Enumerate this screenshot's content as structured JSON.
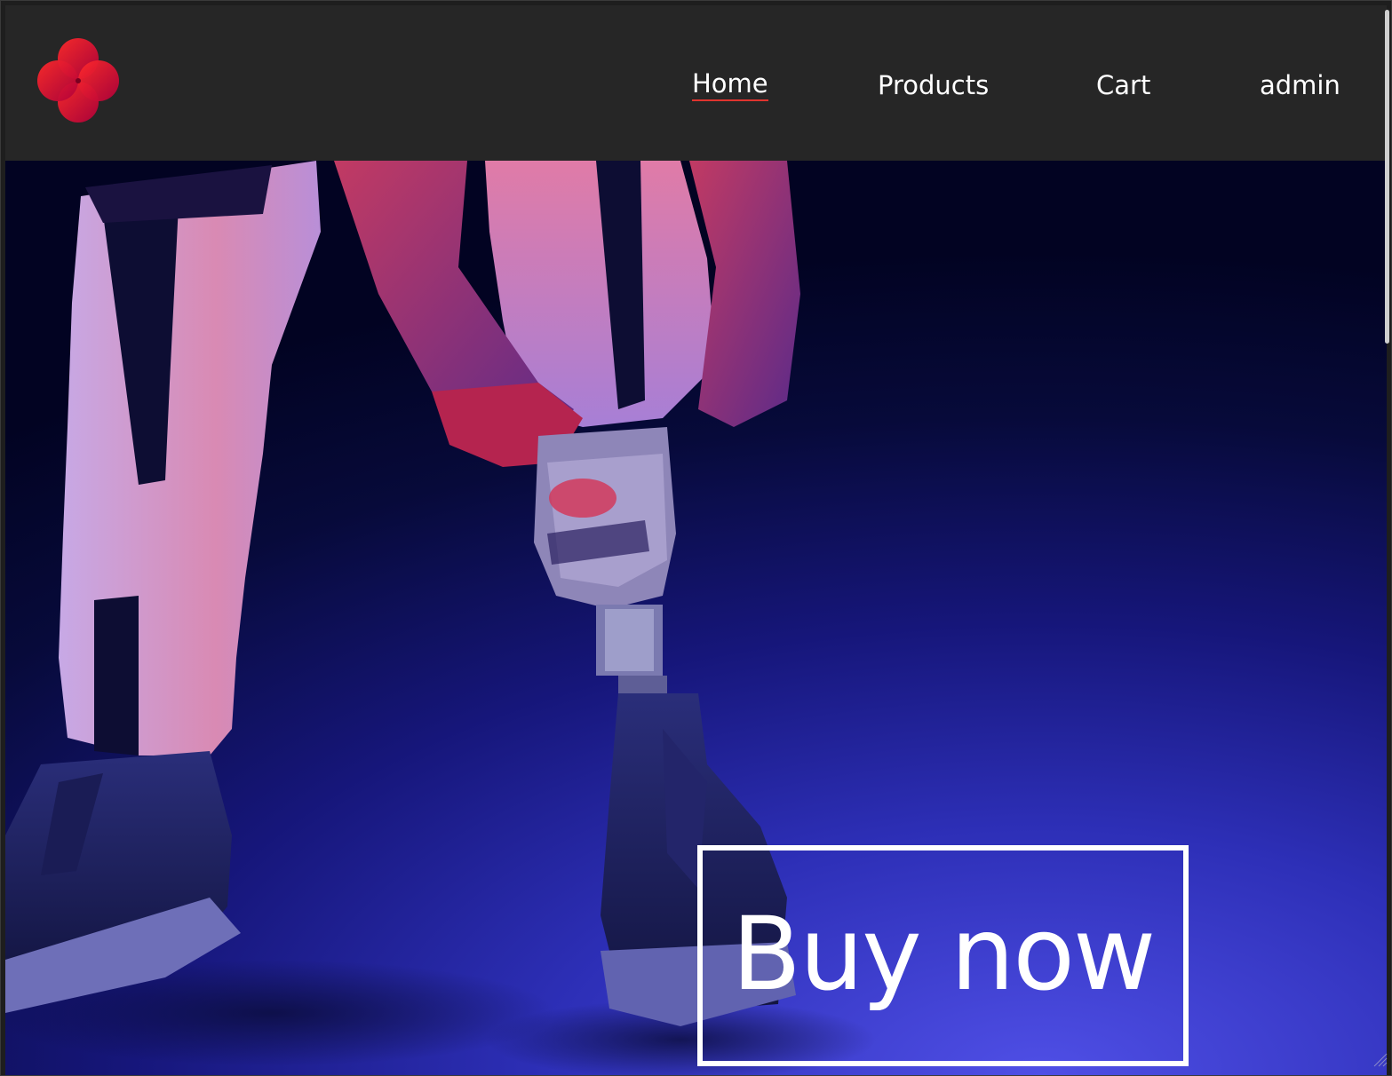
{
  "nav": {
    "logo_icon": "red-flower-logo-icon",
    "links": [
      {
        "label": "Home",
        "active": true
      },
      {
        "label": "Products",
        "active": false
      },
      {
        "label": "Cart",
        "active": false
      },
      {
        "label": "admin",
        "active": false
      }
    ]
  },
  "hero": {
    "image": "person-with-prosthetic-leg-photo",
    "cta_label": "Buy now"
  },
  "colors": {
    "nav_background": "#262626",
    "logo_red": "#e0141e",
    "active_underline": "#e0342e",
    "hero_blue": "#2d2fb7",
    "text": "#ffffff"
  }
}
